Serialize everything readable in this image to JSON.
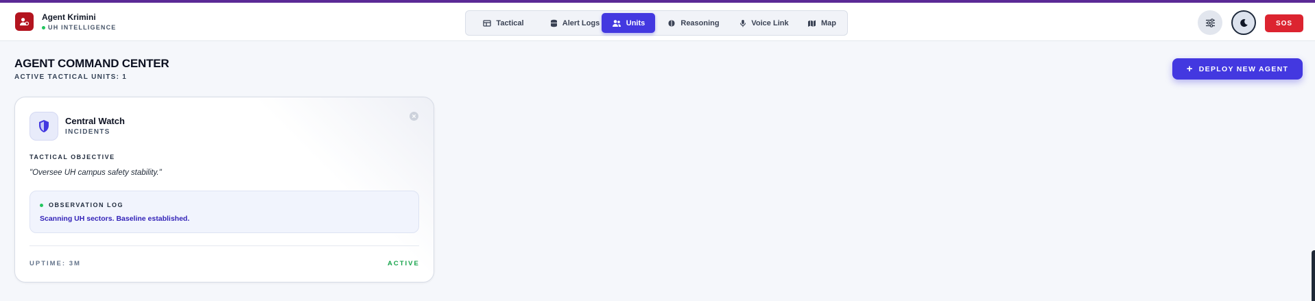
{
  "app": {
    "name": "Agent Krimini",
    "subtitle": "UH INTELLIGENCE"
  },
  "nav": {
    "tabs": [
      {
        "label": "Tactical",
        "icon": "layout-icon",
        "active": false
      },
      {
        "label": "Alert Logs",
        "icon": "database-icon",
        "active": false
      },
      {
        "label": "Units",
        "icon": "users-icon",
        "active": true
      },
      {
        "label": "Reasoning",
        "icon": "brain-icon",
        "active": false
      },
      {
        "label": "Voice Link",
        "icon": "microphone-icon",
        "active": false
      },
      {
        "label": "Map",
        "icon": "map-icon",
        "active": false
      }
    ]
  },
  "header_actions": {
    "settings_icon": "sliders-icon",
    "theme_icon": "moon-icon",
    "sos_label": "SOS"
  },
  "page": {
    "title": "AGENT COMMAND CENTER",
    "subtitle": "ACTIVE TACTICAL UNITS: 1",
    "deploy_label": "DEPLOY NEW AGENT"
  },
  "units": [
    {
      "name": "Central Watch",
      "type": "INCIDENTS",
      "objective_label": "TACTICAL OBJECTIVE",
      "objective": "\"Oversee UH campus safety stability.\"",
      "log_label": "OBSERVATION LOG",
      "log_text": "Scanning UH sectors. Baseline established.",
      "uptime": "UPTIME: 3M",
      "status": "ACTIVE"
    }
  ],
  "colors": {
    "accent": "#4338e0",
    "brand": "#b3141f",
    "sos": "#dc2430",
    "status_active": "#16a34a",
    "top_strip": "#5b2a96"
  }
}
